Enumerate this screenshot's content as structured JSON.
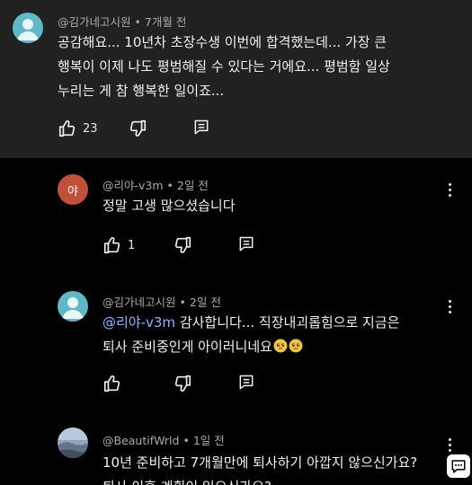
{
  "comments": [
    {
      "author": "@김가네고시원",
      "time": "7개월 전",
      "lines": [
        "공감해요... 10년차 초장수생 이번에 합격했는데... 가장 큰",
        "행복이 이제 나도 평범해질 수 있다는 거에요... 평범함 일상",
        "누리는 게 참 행복한 일이죠..."
      ],
      "likes": "23",
      "avatar_color": "#5eb8c8"
    },
    {
      "author": "@리야-v3m",
      "time": "2일 전",
      "lines": [
        "정말 고생 많으셨습니다"
      ],
      "likes": "1",
      "avatar_letter": "야",
      "avatar_color": "#c0503a"
    },
    {
      "author": "@김가네고시원",
      "time": "2일 전",
      "mention": "@리야-v3m",
      "line1_rest": " 감사합니다... 직장내괴롭힘으로 지금은",
      "line2": "퇴사 준비중인게 아이러니네요",
      "emoji": "pleading-face",
      "avatar_color": "#5eb8c8"
    },
    {
      "author": "@BeautifWrld",
      "time": "1일 전",
      "lines": [
        "10년 준비하고 7개월만에 퇴사하기 아깝지 않으신가요?",
        "퇴사 이후 계획이 있으신가요?"
      ],
      "avatar_color": "#7d8fa8"
    }
  ],
  "separator": "•",
  "icons": {
    "like": "thumb-up-icon",
    "dislike": "thumb-down-icon",
    "reply": "reply-icon",
    "more": "more-vert-icon",
    "fab": "chat-bubble-icon"
  }
}
